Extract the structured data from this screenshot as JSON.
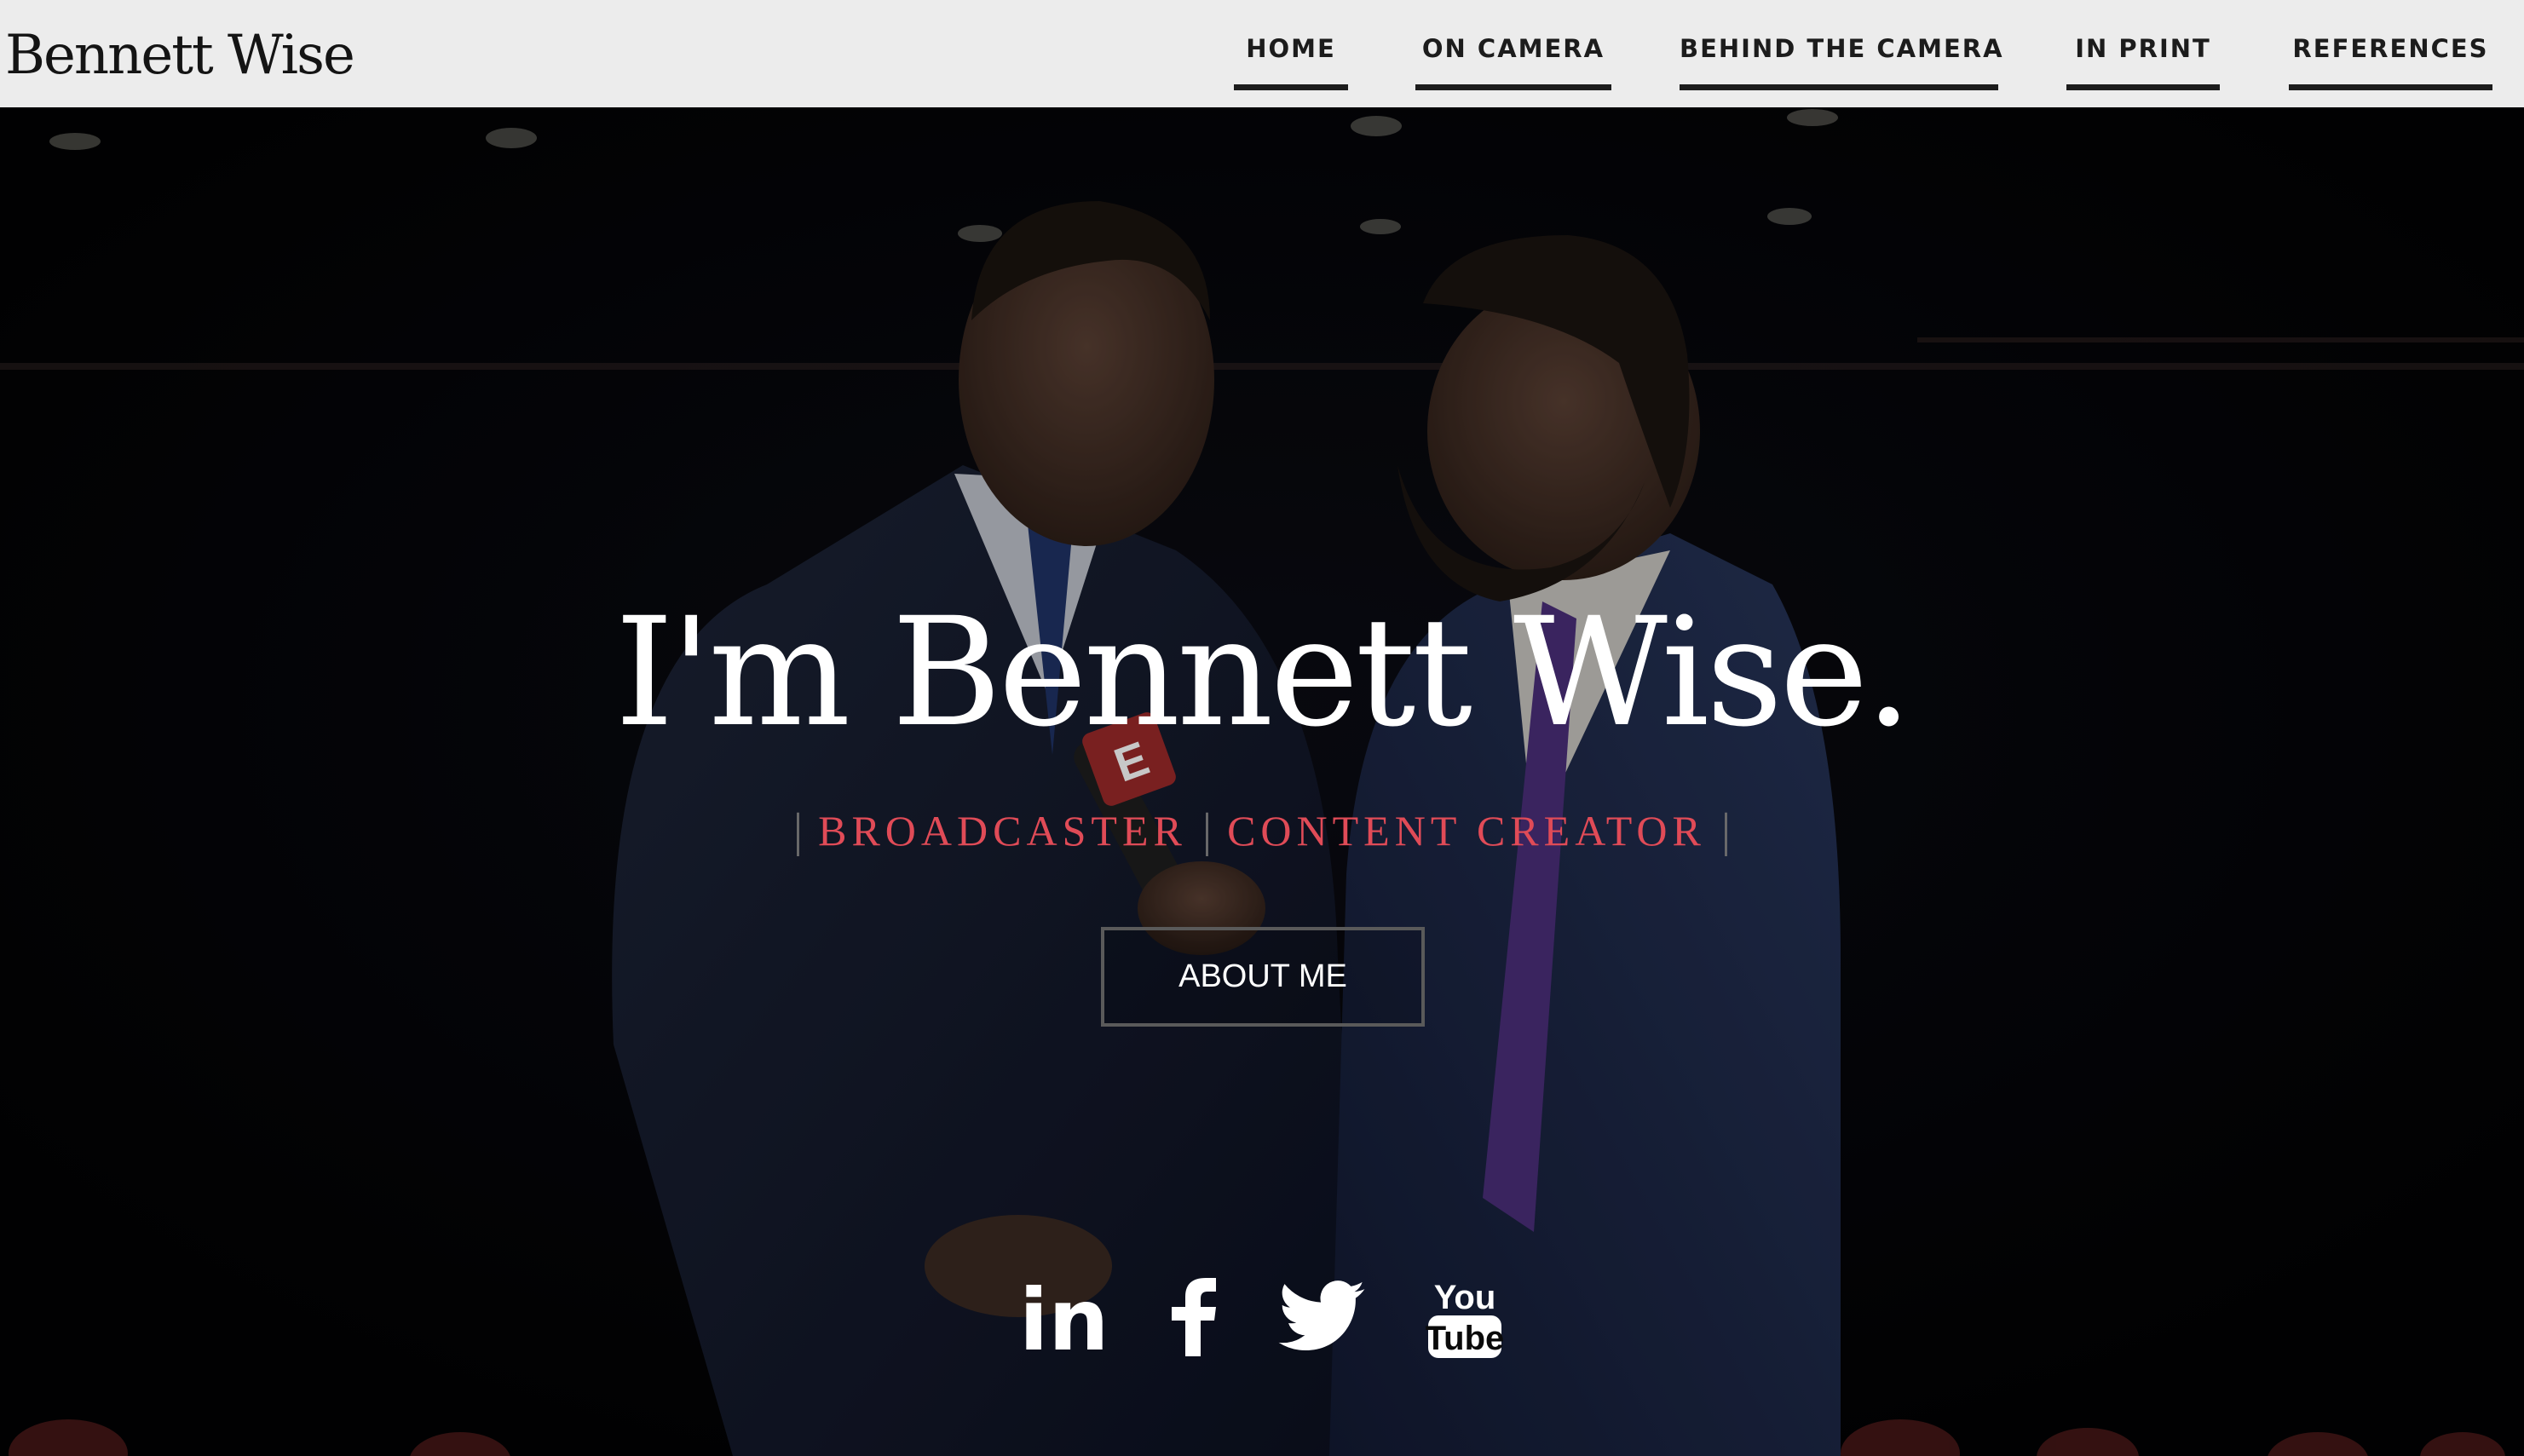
{
  "header": {
    "brand": "Bennett Wise",
    "nav": [
      {
        "label": "HOME"
      },
      {
        "label": "ON CAMERA"
      },
      {
        "label": "BEHIND THE CAMERA"
      },
      {
        "label": "IN PRINT"
      },
      {
        "label": "REFERENCES"
      }
    ]
  },
  "hero": {
    "title": "I'm Bennett Wise.",
    "roles": [
      "BROADCASTER",
      "CONTENT CREATOR"
    ],
    "separator": "|",
    "cta_label": "ABOUT ME",
    "mic_flag_text": "E",
    "social": [
      {
        "icon": "linkedin-icon",
        "text": "in"
      },
      {
        "icon": "facebook-icon",
        "text": "f"
      },
      {
        "icon": "twitter-icon"
      },
      {
        "icon": "youtube-icon",
        "text_top": "You",
        "text_bottom": "Tube"
      }
    ]
  },
  "colors": {
    "header_bg": "#ececec",
    "nav_text": "#1c1c1c",
    "accent_role": "#e04b57",
    "hero_bg": "#030305",
    "white": "#ffffff"
  }
}
